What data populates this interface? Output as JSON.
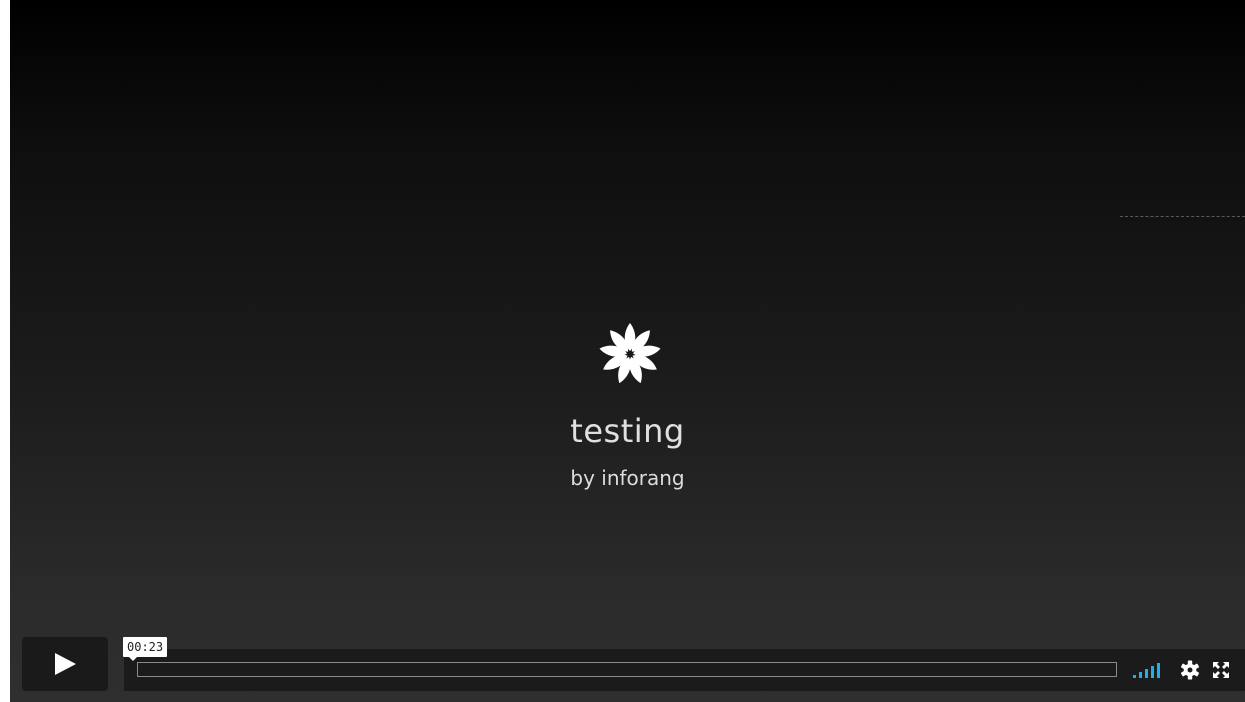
{
  "video": {
    "title": "testing",
    "byline": "by inforang"
  },
  "controls": {
    "time_tooltip": "00:23",
    "play_icon": "play-icon",
    "volume_icon": "volume-bars-icon",
    "settings_icon": "gear-icon",
    "fullscreen_icon": "fullscreen-icon",
    "progress": 0
  },
  "colors": {
    "background_top": "#000000",
    "background_bottom": "#2f2f2f",
    "accent": "#1fb0e8",
    "text": "#e0e0e0"
  }
}
